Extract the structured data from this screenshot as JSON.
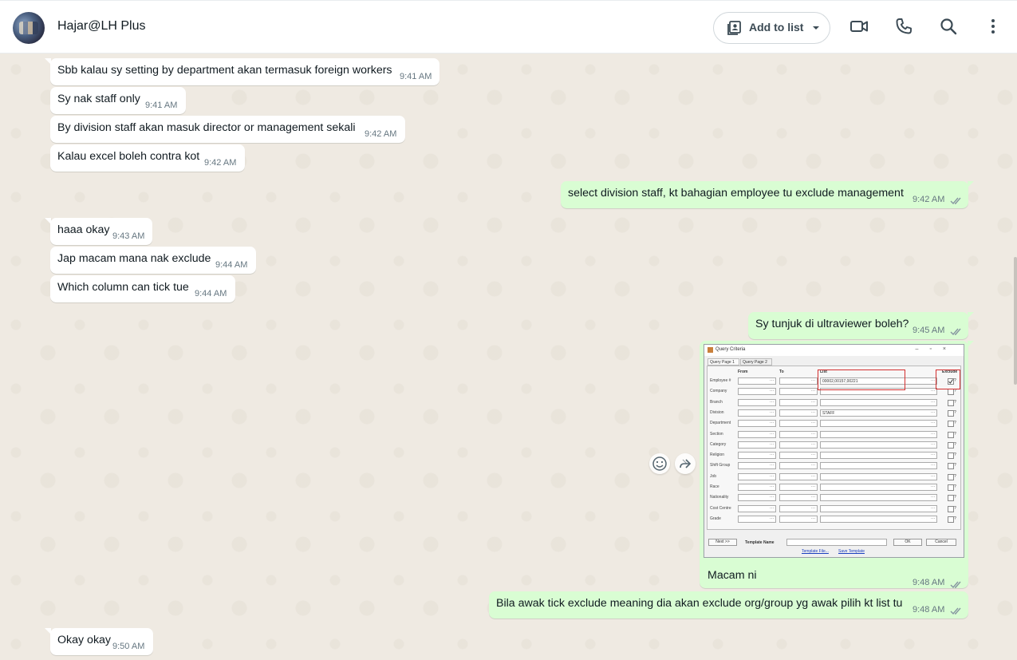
{
  "header": {
    "contact_name": "Hajar@LH Plus",
    "add_to_list_label": "Add to list"
  },
  "colors": {
    "incoming": "#ffffff",
    "outgoing": "#d9fdd3",
    "read_ticks": "#53bdeb",
    "background": "#efeae2"
  },
  "messages": [
    {
      "dir": "in",
      "text": "Sbb kalau sy setting by department akan termasuk foreign workers",
      "time": "9:41 AM"
    },
    {
      "dir": "in",
      "text": "Sy nak staff only",
      "time": "9:41 AM"
    },
    {
      "dir": "in",
      "text": "By division staff akan masuk director or management sekali",
      "time": "9:42 AM"
    },
    {
      "dir": "in",
      "text": "Kalau excel boleh contra kot",
      "time": "9:42 AM"
    },
    {
      "dir": "out",
      "text": "select division staff, kt bahagian employee tu exclude management",
      "time": "9:42 AM"
    },
    {
      "dir": "in",
      "text": "haaa okay",
      "time": "9:43 AM"
    },
    {
      "dir": "in",
      "text": "Jap macam mana nak exclude",
      "time": "9:44 AM"
    },
    {
      "dir": "in",
      "text": "Which column can tick tue",
      "time": "9:44 AM"
    },
    {
      "dir": "out",
      "text": "Sy tunjuk di ultraviewer boleh?",
      "time": "9:45 AM"
    },
    {
      "dir": "out",
      "text": "Bila awak tick exclude meaning dia akan exclude org/group yg awak pilih kt list tu",
      "time": "9:48 AM"
    },
    {
      "dir": "in",
      "text": "Okay okay",
      "time": "9:50 AM"
    }
  ],
  "image_message": {
    "caption": "Macam ni",
    "time": "9:48 AM",
    "screenshot": {
      "window_title": "Query Criteria",
      "tabs": [
        "Query Page 1",
        "Query Page 2"
      ],
      "columns": {
        "from": "From",
        "to": "To",
        "list": "List",
        "exclude": "Exclude"
      },
      "rows": [
        "Employee #",
        "Company",
        "Branch",
        "Division",
        "Department",
        "Section",
        "Category",
        "Religion",
        "Shift Group",
        "Job",
        "Race",
        "Nationality",
        "Cost Centre",
        "Grade"
      ],
      "employee_list_value": "00002,00157,00221",
      "division_list_value": "STAFF",
      "next_button": "Next >>",
      "template_name_label": "Template Name",
      "ok_button": "OK",
      "cancel_button": "Cancel",
      "template_file_link": "Template File...",
      "save_template_link": "Save Template"
    }
  }
}
